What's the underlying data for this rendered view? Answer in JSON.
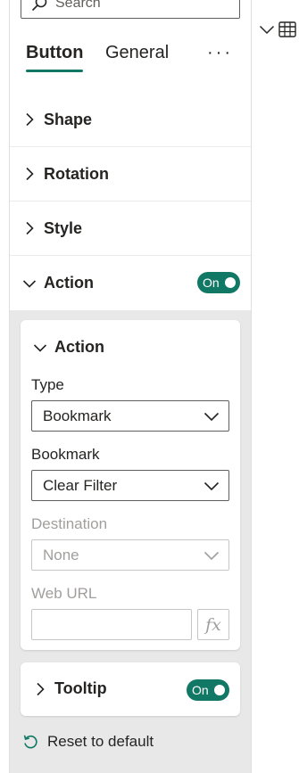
{
  "search": {
    "placeholder": "Search"
  },
  "tabs": [
    {
      "label": "Button",
      "active": true
    },
    {
      "label": "General",
      "active": false
    }
  ],
  "more_label": "···",
  "sections": [
    {
      "label": "Shape"
    },
    {
      "label": "Rotation"
    },
    {
      "label": "Style"
    },
    {
      "label": "Action",
      "expanded": true,
      "toggle": "On"
    }
  ],
  "action_card": {
    "title": "Action",
    "type_label": "Type",
    "type_value": "Bookmark",
    "bookmark_label": "Bookmark",
    "bookmark_value": "Clear Filter",
    "destination_label": "Destination",
    "destination_value": "None",
    "weburl_label": "Web URL",
    "fx_label": "fx"
  },
  "tooltip_card": {
    "title": "Tooltip",
    "toggle": "On"
  },
  "reset_label": "Reset to default",
  "colors": {
    "accent": "#117865",
    "panel_gray": "#e8e8e8"
  },
  "icons": [
    "search-icon",
    "chevron-right-icon",
    "chevron-down-icon",
    "reset-icon",
    "table-icon"
  ]
}
